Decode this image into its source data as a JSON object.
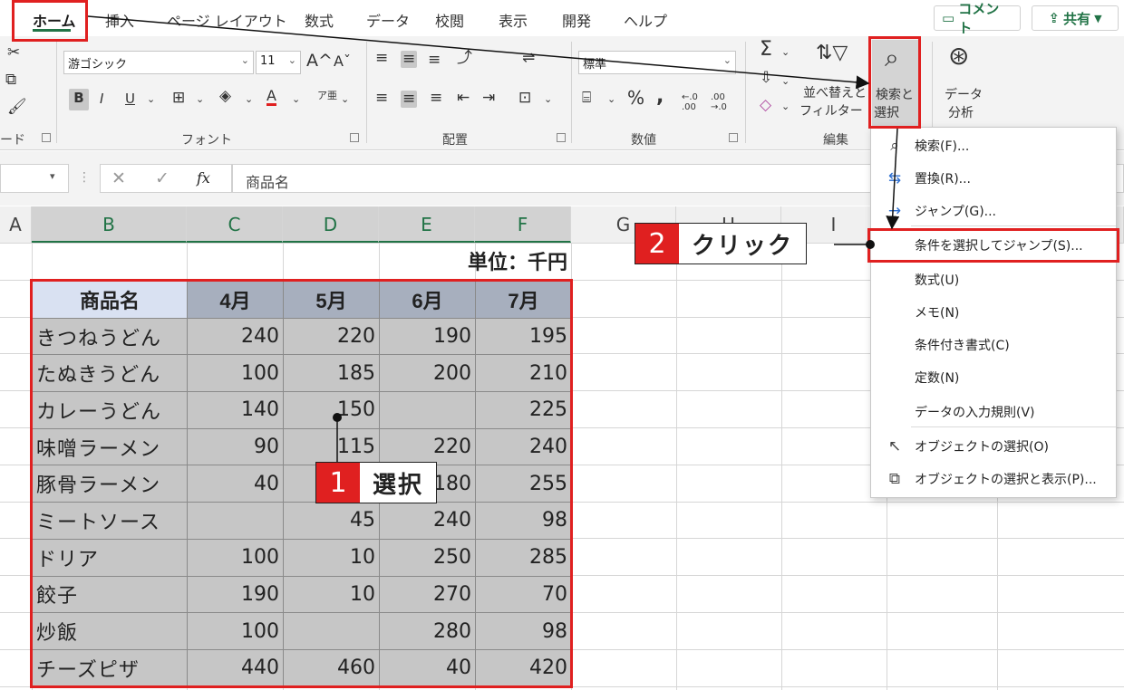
{
  "tabs": [
    "ホーム",
    "挿入",
    "ページ レイアウト",
    "数式",
    "データ",
    "校閲",
    "表示",
    "開発",
    "ヘルプ"
  ],
  "top_buttons": {
    "comment": "コメント",
    "share": "共有"
  },
  "ribbon": {
    "font_name": "游ゴシック",
    "font_size": "11",
    "number_format": "標準",
    "groups": {
      "clipboard": "ード",
      "font": "フォント",
      "alignment": "配置",
      "number": "数値",
      "editing": "編集"
    },
    "sort_filter": [
      "並べ替えと",
      "フィルター"
    ],
    "find_select": [
      "検索と",
      "選択"
    ],
    "analyze": [
      "データ",
      "分析"
    ],
    "bold": "B",
    "italic": "I",
    "underline": "U",
    "text_color": "A",
    "percent": "%",
    "comma": ",",
    "dec_inc": "←.0 .00",
    "dec_dec": ".00 →.0",
    "grow_font": "A^",
    "shrink_font": "Aˇ",
    "phonetic": "ア亜"
  },
  "formula_bar": {
    "value": "商品名",
    "fx": "fx"
  },
  "columns": [
    "A",
    "B",
    "C",
    "D",
    "E",
    "F",
    "G",
    "H",
    "I"
  ],
  "sheet": {
    "unit_label": "単位：千円",
    "headers": [
      "商品名",
      "4月",
      "5月",
      "6月",
      "7月"
    ],
    "rows": [
      [
        "きつねうどん",
        "240",
        "220",
        "190",
        "195"
      ],
      [
        "たぬきうどん",
        "100",
        "185",
        "200",
        "210"
      ],
      [
        "カレーうどん",
        "140",
        "150",
        "",
        "225"
      ],
      [
        "味噌ラーメン",
        "90",
        "115",
        "220",
        "240"
      ],
      [
        "豚骨ラーメン",
        "40",
        "",
        "180",
        "255"
      ],
      [
        "ミートソース",
        "",
        "45",
        "240",
        "98"
      ],
      [
        "ドリア",
        "100",
        "10",
        "250",
        "285"
      ],
      [
        "餃子",
        "190",
        "10",
        "270",
        "70"
      ],
      [
        "炒飯",
        "100",
        "",
        "280",
        "98"
      ],
      [
        "チーズピザ",
        "440",
        "460",
        "40",
        "420"
      ]
    ]
  },
  "menu": {
    "items": [
      {
        "icon": "search-icon",
        "label": "検索(F)..."
      },
      {
        "icon": "replace-icon",
        "label": "置換(R)..."
      },
      {
        "icon": "arrow-right-icon",
        "label": "ジャンプ(G)..."
      },
      {
        "icon": "",
        "label": "条件を選択してジャンプ(S)..."
      },
      {
        "icon": "",
        "label": "数式(U)"
      },
      {
        "icon": "",
        "label": "メモ(N)"
      },
      {
        "icon": "",
        "label": "条件付き書式(C)"
      },
      {
        "icon": "",
        "label": "定数(N)"
      },
      {
        "icon": "",
        "label": "データの入力規則(V)"
      },
      {
        "icon": "cursor-icon",
        "label": "オブジェクトの選択(O)"
      },
      {
        "icon": "selection-pane-icon",
        "label": "オブジェクトの選択と表示(P)..."
      }
    ]
  },
  "callouts": [
    {
      "number": "1",
      "text": "選択"
    },
    {
      "number": "2",
      "text": "クリック"
    }
  ],
  "colors": {
    "accent": "#217346",
    "annotation_red": "#e02020",
    "selection_gray": "#c6c6c6",
    "header_fill": "#a7afbe"
  }
}
